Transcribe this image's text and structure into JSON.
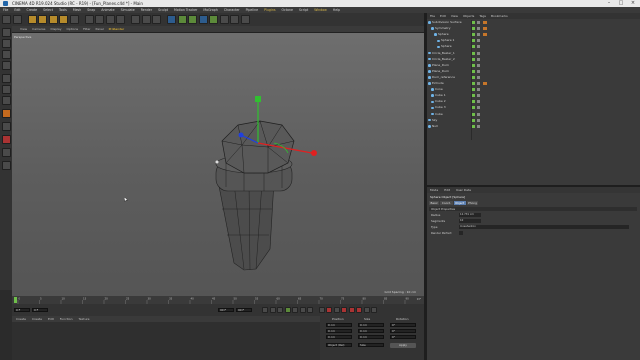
{
  "window": {
    "title": "CINEMA 4D R19.024 Studio (RC - R19) - [Fun_Planes.c4d *] - Main"
  },
  "menubar": {
    "items": [
      "File",
      "Edit",
      "Create",
      "Select",
      "Tools",
      "Mesh",
      "Snap",
      "Animate",
      "Simulate",
      "Render",
      "Sculpt",
      "Motion Tracker",
      "MoGraph",
      "Character",
      "Pipeline",
      "Plugins",
      "Octane",
      "Script",
      "Window",
      "Help"
    ]
  },
  "viewport": {
    "menu": [
      "View",
      "Cameras",
      "Display",
      "Options",
      "Filter",
      "Panel",
      "ProRender"
    ],
    "label": "Perspective",
    "grid_spacing": "Grid Spacing : 10 cm"
  },
  "timeline": {
    "frames": [
      "0",
      "5",
      "10",
      "15",
      "20",
      "25",
      "30",
      "35",
      "40",
      "45",
      "50",
      "55",
      "60",
      "65",
      "70",
      "75",
      "80",
      "85",
      "90"
    ],
    "end": "0 F"
  },
  "playback": {
    "current": "0 F",
    "start": "0 F",
    "end": "90 F",
    "end2": "90 F"
  },
  "material_manager": {
    "menu": [
      "Create",
      "Create",
      "Edit",
      "Function",
      "Texture"
    ]
  },
  "coordinates": {
    "headers": [
      "Position",
      "Size",
      "Rotation"
    ],
    "rows": [
      [
        "0 cm",
        "0 cm",
        "0°"
      ],
      [
        "0 cm",
        "0 cm",
        "0°"
      ],
      [
        "0 cm",
        "0 cm",
        "0°"
      ]
    ],
    "mode": "Object (Rel)",
    "size_mode": "Size",
    "apply": "Apply"
  },
  "object_manager": {
    "menu": [
      "File",
      "Edit",
      "View",
      "Objects",
      "Tags",
      "Bookmarks"
    ],
    "objects": [
      {
        "name": "Subdivision Surface",
        "indent": 0,
        "color": "#6fb4e8",
        "selected": false
      },
      {
        "name": "Symmetry",
        "indent": 1,
        "color": "#6fb4e8",
        "selected": false
      },
      {
        "name": "Sphere",
        "indent": 2,
        "color": "#6fb4e8",
        "selected": false
      },
      {
        "name": "Sphere 1",
        "indent": 3,
        "color": "#6fb4e8",
        "selected": false
      },
      {
        "name": "Sphere",
        "indent": 3,
        "color": "#6fb4e8",
        "selected": false
      },
      {
        "name": "Circle_Bezier_1",
        "indent": 0,
        "color": "#6fb4e8",
        "selected": false
      },
      {
        "name": "Circle_Bezier_2",
        "indent": 0,
        "color": "#6fb4e8",
        "selected": false
      },
      {
        "name": "Plane_Dum",
        "indent": 0,
        "color": "#6fb4e8",
        "selected": false
      },
      {
        "name": "Plane_Dum",
        "indent": 0,
        "color": "#6fb4e8",
        "selected": false
      },
      {
        "name": "Dum_reference",
        "indent": 0,
        "color": "#6fb4e8",
        "selected": false
      },
      {
        "name": "Extrude",
        "indent": 0,
        "color": "#6fb4e8",
        "selected": false
      },
      {
        "name": "Cone",
        "indent": 1,
        "color": "#6fb4e8",
        "selected": false
      },
      {
        "name": "Cube 1",
        "indent": 1,
        "color": "#6fb4e8",
        "selected": false
      },
      {
        "name": "Cube 2",
        "indent": 1,
        "color": "#6fb4e8",
        "selected": false
      },
      {
        "name": "Cube 3",
        "indent": 1,
        "color": "#6fb4e8",
        "selected": false
      },
      {
        "name": "Cube",
        "indent": 1,
        "color": "#6fb4e8",
        "selected": false
      },
      {
        "name": "Sky",
        "indent": 0,
        "color": "#6fb4e8",
        "selected": false
      },
      {
        "name": "Null",
        "indent": 0,
        "color": "#6fb4e8",
        "selected": false
      }
    ]
  },
  "attributes": {
    "menu": [
      "Mode",
      "Edit",
      "User Data"
    ],
    "title": "Sphere Object [Sphere]",
    "tabs": [
      "Basic",
      "Coord.",
      "Object",
      "Phong"
    ],
    "active_tab": "Object",
    "section": "Object Properties",
    "params": [
      {
        "label": "Radius",
        "value": "12.731 cm"
      },
      {
        "label": "Segments",
        "value": "10"
      },
      {
        "label": "Type",
        "value": "Icosahedron"
      },
      {
        "label": "Render Perfect",
        "value": ""
      }
    ]
  },
  "colors": {
    "accent": "#d8b84a",
    "selection": "#4c5a70",
    "axis_x": "#e02020",
    "axis_y": "#30c030",
    "axis_z": "#2040e0"
  }
}
